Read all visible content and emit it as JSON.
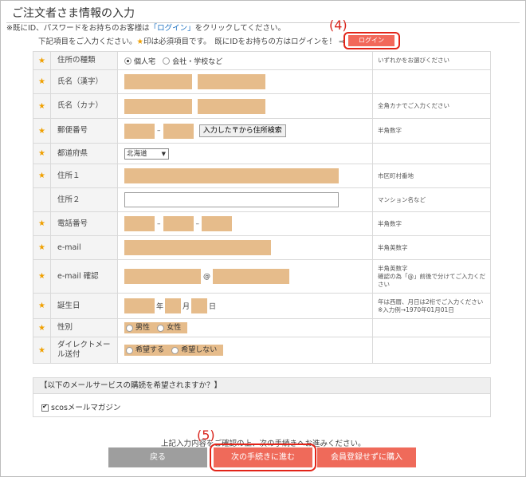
{
  "header": {
    "title": "ご注文者さま情報の入力",
    "note_prefix": "※既にID、パスワードをお持ちのお客様は",
    "note_link": "「ログイン」",
    "note_suffix": "をクリックしてください。",
    "req_prefix": "下記項目をご入力ください。",
    "req_star": "★",
    "req_text": "印は必須項目です。　既にIDをお持ちの方はログインを！ ⇒",
    "login_button": "ログイン"
  },
  "annotations": {
    "a4": "(4)",
    "a5": "(5)"
  },
  "form": {
    "star": "★",
    "rows": [
      {
        "label": "住所の種類",
        "note": "いずれかをお選びください",
        "options": [
          "個人宅",
          "会社・学校など"
        ]
      },
      {
        "label": "氏名（漢字）",
        "note": ""
      },
      {
        "label": "氏名（カナ）",
        "note": "全角カナでご入力ください"
      },
      {
        "label": "郵便番号",
        "note": "半角数字",
        "sep": "–",
        "search_button": "入力した〒から住所検索"
      },
      {
        "label": "都道府県",
        "note": "",
        "select_value": "北海道"
      },
      {
        "label": "住所１",
        "note": "市区町村番地"
      },
      {
        "label": "住所２",
        "note": "マンション名など"
      },
      {
        "label": "電話番号",
        "note": "半角数字",
        "sep": "–"
      },
      {
        "label": "e-mail",
        "note": "半角英数字"
      },
      {
        "label": "e-mail 確認",
        "note": "半角英数字",
        "note2": "確認の為「@」前後で分けてご入力ください",
        "at": "@"
      },
      {
        "label": "誕生日",
        "note": "年は西暦、月日は2桁でご入力ください",
        "note2": "※入力例→1970年01月01日",
        "year": "年",
        "month": "月",
        "day": "日"
      },
      {
        "label": "性別",
        "note": "",
        "options": [
          "男性",
          "女性"
        ]
      },
      {
        "label": "ダイレクトメール送付",
        "note": "",
        "options": [
          "希望する",
          "希望しない"
        ]
      }
    ]
  },
  "mail": {
    "heading": "【以下のメールサービスの購読を希望されますか？】",
    "option": "scosメールマガジン"
  },
  "footer": {
    "text": "上記入力内容をご確認の上、次の手続きへお進みください。",
    "back": "戻る",
    "next": "次の手続きに進む",
    "guest": "会員登録せずに購入"
  }
}
